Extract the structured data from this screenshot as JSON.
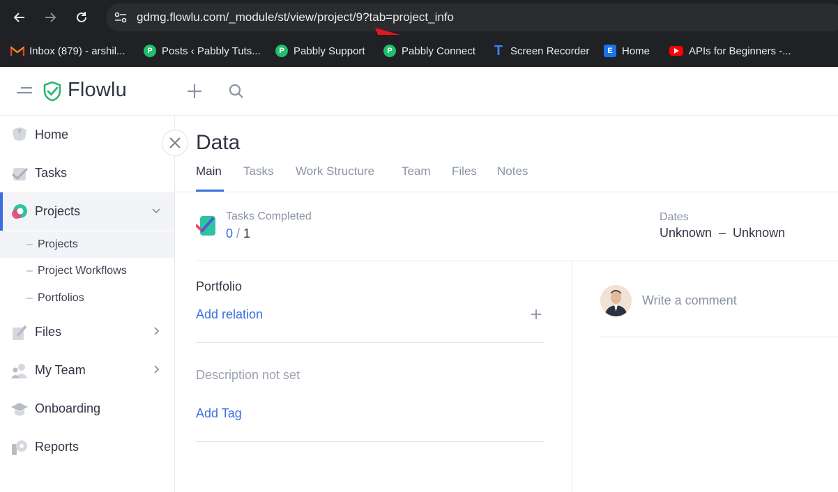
{
  "browser": {
    "url": "gdmg.flowlu.com/_module/st/view/project/9?tab=project_info",
    "bookmarks": [
      {
        "label": "Inbox (879) - arshil...",
        "icon": "gmail-icon",
        "color": "#ea4335"
      },
      {
        "label": "Posts ‹ Pabbly Tuts...",
        "icon": "pabbly-icon",
        "color": "#1fbf6b"
      },
      {
        "label": "Pabbly Support",
        "icon": "pabbly-icon",
        "color": "#1fbf6b"
      },
      {
        "label": "Pabbly Connect",
        "icon": "pabbly-icon",
        "color": "#1fbf6b"
      },
      {
        "label": "Screen Recorder",
        "icon": "t-icon",
        "color": "#3b82f6"
      },
      {
        "label": "Home",
        "icon": "e-icon",
        "color": "#1a73e8"
      },
      {
        "label": "APIs for Beginners -...",
        "icon": "youtube-icon",
        "color": "#ff0000"
      }
    ]
  },
  "app": {
    "logo": "Flowlu",
    "accent": "#3b6fe0"
  },
  "sidebar": {
    "items": [
      {
        "label": "Home"
      },
      {
        "label": "Tasks"
      },
      {
        "label": "Projects"
      },
      {
        "label": "Files"
      },
      {
        "label": "My Team"
      },
      {
        "label": "Onboarding"
      },
      {
        "label": "Reports"
      }
    ],
    "subitems": [
      {
        "label": "Projects"
      },
      {
        "label": "Project Workflows"
      },
      {
        "label": "Portfolios"
      }
    ]
  },
  "main": {
    "title": "Data",
    "tabs": [
      {
        "label": "Main"
      },
      {
        "label": "Tasks"
      },
      {
        "label": "Work Structure"
      },
      {
        "label": "Team"
      },
      {
        "label": "Files"
      },
      {
        "label": "Notes"
      }
    ],
    "tasks_completed_label": "Tasks Completed",
    "tasks_done": "0",
    "tasks_sep": " / ",
    "tasks_total": "1",
    "dates_label": "Dates",
    "dates_value": "Unknown  –  Unknown",
    "portfolio_title": "Portfolio",
    "add_relation": "Add relation",
    "description": "Description not set",
    "add_tag": "Add Tag",
    "comment_placeholder": "Write a comment"
  }
}
